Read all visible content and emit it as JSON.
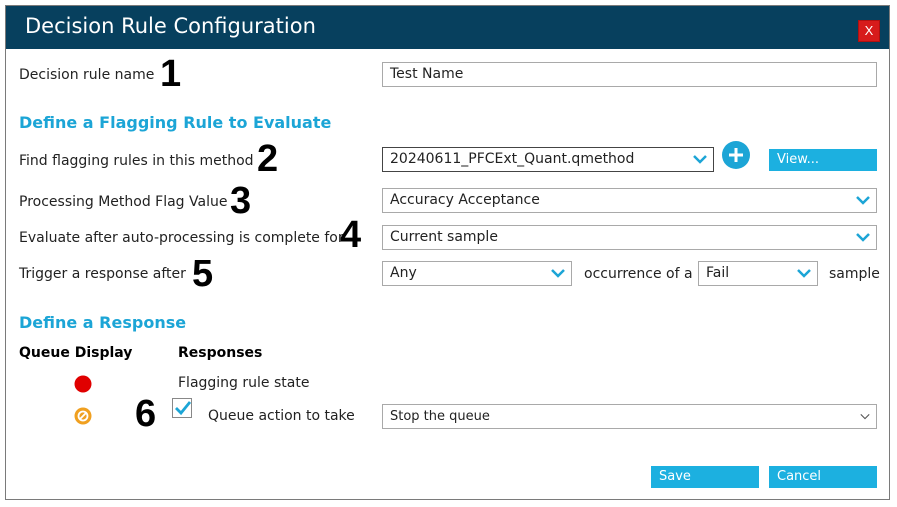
{
  "dialog": {
    "title": "Decision Rule Configuration",
    "close_label": "X"
  },
  "rule_name": {
    "label": "Decision rule name",
    "value": "Test Name"
  },
  "flagging": {
    "section_title": "Define a Flagging Rule to Evaluate",
    "find_label": "Find flagging rules in this method",
    "method_value": "20240611_PFCExt_Quant.qmethod",
    "view_button": "View...",
    "flag_value_label": "Processing Method Flag Value",
    "flag_value": "Accuracy Acceptance",
    "evaluate_label": "Evaluate after auto-processing is complete for",
    "evaluate_value": "Current sample",
    "trigger_label": "Trigger a response after",
    "trigger_count": "Any",
    "occurrence_text": "occurrence of a",
    "trigger_result": "Fail",
    "sample_text": "sample"
  },
  "response": {
    "section_title": "Define a Response",
    "queue_display_header": "Queue Display",
    "responses_header": "Responses",
    "rule_state_label": "Flagging rule state",
    "queue_action_label": "Queue action to take",
    "queue_action_checked": true,
    "queue_action_value": "Stop the queue",
    "colors": {
      "state_dot": "#e00000",
      "queue_icon": "#f0a020"
    }
  },
  "footer": {
    "save": "Save",
    "cancel": "Cancel"
  },
  "callouts": [
    "1",
    "2",
    "3",
    "4",
    "5",
    "6"
  ],
  "accent_color": "#1ca5d6",
  "titlebar_color": "#07405e"
}
